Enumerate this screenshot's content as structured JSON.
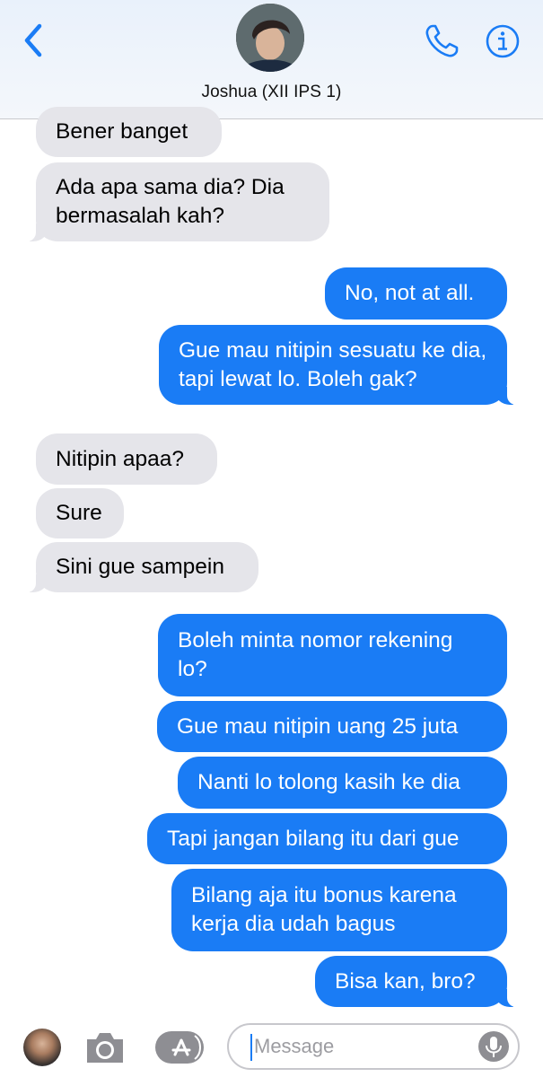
{
  "header": {
    "contact_name": "Joshua (XII IPS 1)",
    "back_icon": "chevron-left-icon",
    "call_icon": "phone-icon",
    "info_icon": "info-icon"
  },
  "colors": {
    "accent": "#1a7cf5",
    "incoming_bubble": "#e5e5ea",
    "outgoing_bubble": "#1a7cf5"
  },
  "messages": [
    {
      "sender": "incoming",
      "text": "Bener banget"
    },
    {
      "sender": "incoming",
      "text": "Ada apa sama dia? Dia bermasalah kah?"
    },
    {
      "sender": "outgoing",
      "text": "No, not at all."
    },
    {
      "sender": "outgoing",
      "text": "Gue mau nitipin sesuatu ke dia, tapi lewat lo. Boleh gak?"
    },
    {
      "sender": "incoming",
      "text": "Nitipin apaa?"
    },
    {
      "sender": "incoming",
      "text": "Sure"
    },
    {
      "sender": "incoming",
      "text": "Sini gue sampein"
    },
    {
      "sender": "outgoing",
      "text": "Boleh minta nomor rekening lo?"
    },
    {
      "sender": "outgoing",
      "text": "Gue mau nitipin uang 25 juta"
    },
    {
      "sender": "outgoing",
      "text": "Nanti lo tolong kasih ke dia"
    },
    {
      "sender": "outgoing",
      "text": "Tapi jangan bilang itu dari gue"
    },
    {
      "sender": "outgoing",
      "text": "Bilang aja itu bonus karena kerja dia udah bagus"
    },
    {
      "sender": "outgoing",
      "text": "Bisa kan, bro?"
    }
  ],
  "composer": {
    "placeholder": "Message",
    "camera_icon": "camera-icon",
    "apps_icon": "app-store-icon",
    "mic_icon": "microphone-icon"
  }
}
